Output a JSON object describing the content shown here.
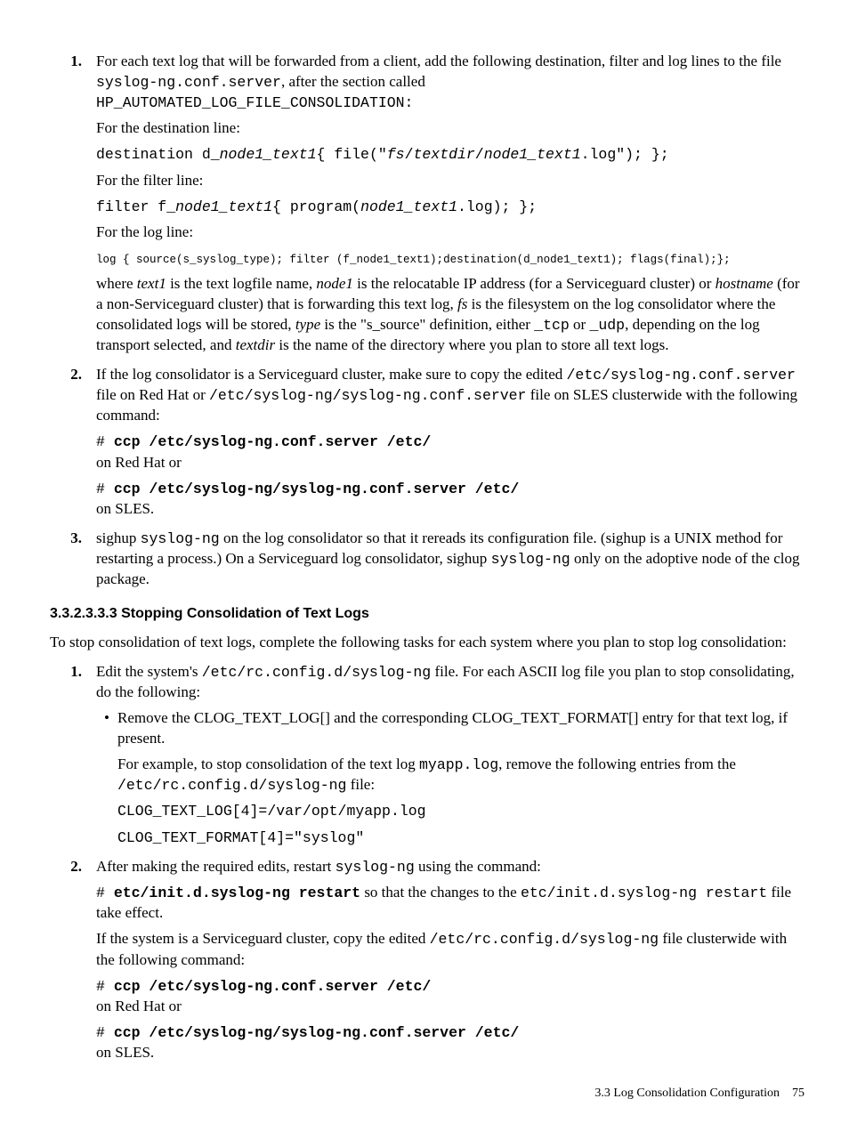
{
  "l1_intro1": "For each text log that will be forwarded from a client, add the following destination, filter and log lines to the file ",
  "l1_code1": "syslog-ng.conf.server",
  "l1_intro2": ", after the section called ",
  "l1_code2": "HP_AUTOMATED_LOG_FILE_CONSOLIDATION:",
  "l1_destline": "For the destination line:",
  "l1_dest_code_a": "destination d_",
  "l1_dest_code_b": "node1_text1",
  "l1_dest_code_c": "{ file(\"",
  "l1_dest_code_d": "fs",
  "l1_dest_code_e": "/",
  "l1_dest_code_f": "textdir",
  "l1_dest_code_g": "/",
  "l1_dest_code_h": "node1_text1",
  "l1_dest_code_i": ".log\"); };",
  "l1_filtline": "For the filter line:",
  "l1_filt_a": "filter f_",
  "l1_filt_b": "node1_text1",
  "l1_filt_c": "{ program(",
  "l1_filt_d": "node1_text1",
  "l1_filt_e": ".log); };",
  "l1_logline": "For the log line:",
  "l1_logcode": "log { source(s_syslog_type); filter (f_node1_text1);destination(d_node1_text1); flags(final);};",
  "l1_where_1": "where ",
  "l1_where_2": "text1",
  "l1_where_3": " is the text logfile name, ",
  "l1_where_4": "node1",
  "l1_where_5": " is the relocatable IP address (for a Serviceguard cluster) or ",
  "l1_where_6": "hostname",
  "l1_where_7": " (for a non-Serviceguard cluster) that is forwarding this text log, ",
  "l1_where_8": "fs",
  "l1_where_9": " is the filesystem on the log consolidator where the consolidated logs will be stored, ",
  "l1_where_10": "type",
  "l1_where_11": " is the \"s_source\" definition, either ",
  "l1_where_12": "_tcp",
  "l1_where_13": " or ",
  "l1_where_14": "_udp",
  "l1_where_15": ", depending on the log transport selected, and ",
  "l1_where_16": "textdir",
  "l1_where_17": " is the name of the directory where you plan to store all text logs.",
  "l2_a": "If the log consolidator is a Serviceguard cluster, make sure to copy the edited ",
  "l2_b": "/etc/syslog-ng.conf.server",
  "l2_c": " file on Red Hat or ",
  "l2_d": "/etc/syslog-ng/syslog-ng.conf.server",
  "l2_e": " file on SLES clusterwide with the following command:",
  "l2_cmd1_hash": "# ",
  "l2_cmd1": "ccp /etc/syslog-ng.conf.server /etc/",
  "l2_redhat": "on Red Hat or",
  "l2_cmd2_hash": "# ",
  "l2_cmd2": "ccp /etc/syslog-ng/syslog-ng.conf.server /etc/",
  "l2_sles": "on SLES.",
  "l3_a": "sighup ",
  "l3_b": "syslog-ng",
  "l3_c": " on the log consolidator so that it rereads its configuration file. (sighup is a UNIX method for restarting a process.) On a Serviceguard log consolidator, sighup ",
  "l3_d": "syslog-ng",
  "l3_e": " only on the adoptive node of the clog package.",
  "sec_hdr": "3.3.2.3.3.3 Stopping Consolidation of Text Logs",
  "sec_intro": "To stop consolidation of text logs, complete the following tasks for each system where you plan to stop log consolidation:",
  "s1_a": "Edit the system's ",
  "s1_b": "/etc/rc.config.d/syslog-ng",
  "s1_c": " file. For each ASCII log file you plan to stop consolidating, do the following:",
  "s1_bul_a": "Remove the CLOG_TEXT_LOG[] and the corresponding CLOG_TEXT_FORMAT[] entry for that text log, if present.",
  "s1_bul_b1": "For example, to stop consolidation of the text log ",
  "s1_bul_b2": "myapp.log",
  "s1_bul_b3": ", remove the following entries from the ",
  "s1_bul_b4": "/etc/rc.config.d/syslog-ng",
  "s1_bul_b5": " file:",
  "s1_code1": "CLOG_TEXT_LOG[4]=/var/opt/myapp.log",
  "s1_code2": "CLOG_TEXT_FORMAT[4]=\"syslog\"",
  "s2_a": "After making the required edits, restart ",
  "s2_b": "syslog-ng",
  "s2_c": " using the command:",
  "s2_cmd_hash": "# ",
  "s2_cmd": "etc/init.d.syslog-ng restart",
  "s2_after1": " so that the changes to the ",
  "s2_after2": "etc/init.d.syslog-ng restart",
  "s2_after3": " file take effect.",
  "s2_p2_a": "If the system is a Serviceguard cluster, copy the edited ",
  "s2_p2_b": "/etc/rc.config.d/syslog-ng",
  "s2_p2_c": " file clusterwide with the following command:",
  "s2_cmd2_hash": "# ",
  "s2_cmd2": "ccp /etc/syslog-ng.conf.server /etc/",
  "s2_redhat": "on Red Hat or",
  "s2_cmd3_hash": "# ",
  "s2_cmd3": "ccp /etc/syslog-ng/syslog-ng.conf.server /etc/",
  "s2_sles": "on SLES.",
  "footer_section": "3.3 Log Consolidation Configuration",
  "footer_page": "75",
  "num1": "1.",
  "num2": "2.",
  "num3": "3.",
  "bullet": "•"
}
